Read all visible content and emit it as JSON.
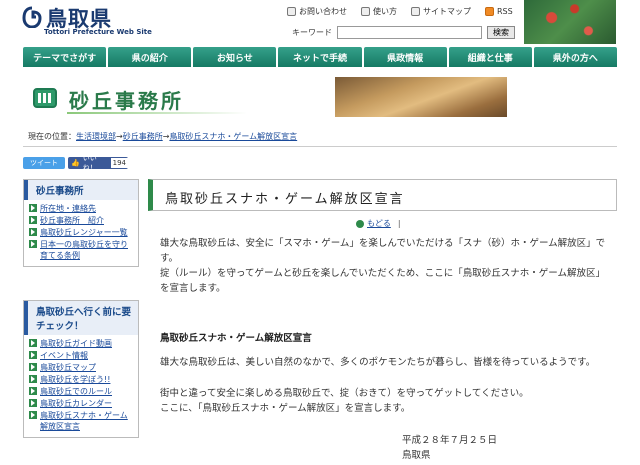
{
  "header": {
    "logo_text": "鳥取県",
    "logo_sub": "Tottori Prefecture Web Site",
    "util_links": [
      {
        "label": "お問い合わせ",
        "icon": "mail-icon"
      },
      {
        "label": "使い方",
        "icon": "help-icon"
      },
      {
        "label": "サイトマップ",
        "icon": "sitemap-icon"
      },
      {
        "label": "RSS",
        "icon": "rss-icon"
      }
    ],
    "search_label": "キーワード",
    "search_value": "",
    "search_button": "検索"
  },
  "nav": {
    "items": [
      "テーマでさがす",
      "県の紹介",
      "お知らせ",
      "ネットで手続",
      "県政情報",
      "組織と仕事",
      "県外の方へ"
    ]
  },
  "banner": {
    "title": "砂丘事務所"
  },
  "breadcrumb": {
    "prefix": "現在の位置：",
    "items": [
      "生活環境部",
      "砂丘事務所",
      "鳥取砂丘スナホ・ゲーム解放区宣言"
    ],
    "sep": "→"
  },
  "social": {
    "tweet": "ツイート",
    "like": "いいね！",
    "like_count": "194"
  },
  "sidebar": {
    "box1": {
      "heading": "砂丘事務所",
      "items": [
        "所在地・連絡先",
        "砂丘事務所　紹介",
        "鳥取砂丘レンジャー一覧",
        "日本一の鳥取砂丘を守り育てる条例"
      ]
    },
    "box2": {
      "heading": "鳥取砂丘へ行く前に要チェック！",
      "items": [
        "鳥取砂丘ガイド動画",
        "イベント情報",
        "鳥取砂丘マップ",
        "鳥取砂丘を学ぼう!!",
        "鳥取砂丘でのルール",
        "鳥取砂丘カレンダー",
        "鳥取砂丘スナホ・ゲーム解放区宣言"
      ]
    }
  },
  "main": {
    "title": "鳥取砂丘スナホ・ゲーム解放区宣言",
    "back": "もどる",
    "back_sep": "|",
    "intro1": "雄大な鳥取砂丘は、安全に「スマホ・ゲーム」を楽しんでいただける「スナ（砂）ホ・ゲーム解放区」です。",
    "intro2": "掟（ルール）を守ってゲームと砂丘を楽しんでいただくため、ここに「鳥取砂丘スナホ・ゲーム解放区」を宣言します。",
    "section_title": "鳥取砂丘スナホ・ゲーム解放区宣言",
    "decl1": "雄大な鳥取砂丘は、美しい自然のなかで、多くのポケモンたちが暮らし、皆様を待っているようです。",
    "decl2": "街中と違って安全に楽しめる鳥取砂丘で、掟（おきて）を守ってゲットしてください。",
    "decl3": "ここに、「鳥取砂丘スナホ・ゲーム解放区」を宣言します。",
    "date": "平成２８年７月２５日",
    "signer": "鳥取県"
  },
  "colors": {
    "nav": "#1e8a70",
    "accent": "#2e8a4a",
    "link": "#1a4a9a"
  }
}
